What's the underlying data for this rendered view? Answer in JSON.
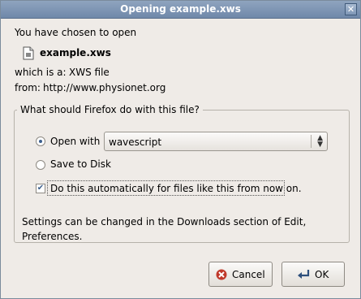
{
  "window": {
    "title": "Opening example.xws"
  },
  "intro": {
    "chosen_text": "You have chosen to open",
    "filename": "example.xws",
    "which_is_label": "which is a:",
    "which_is_value": "XWS file",
    "from_label": "from:",
    "from_value": "http://www.physionet.org"
  },
  "action_group": {
    "legend": "What should Firefox do with this file?",
    "open_with_label": "Open with",
    "open_with_selected": true,
    "app_select_value": "wavescript",
    "save_to_disk_label": "Save to Disk",
    "save_to_disk_selected": false,
    "auto_label": "Do this automatically for files like this from now on.",
    "auto_checked": true,
    "note_line1": "Settings can be changed in the Downloads section of Edit,",
    "note_line2": "Preferences."
  },
  "buttons": {
    "cancel_label": "Cancel",
    "ok_label": "OK"
  },
  "icons": {
    "file": "document-icon",
    "cancel": "cancel-x-icon",
    "ok": "ok-arrow-icon"
  },
  "colors": {
    "titlebar": "#7890ae",
    "window_bg": "#efebe7",
    "cancel_icon": "#c0392b"
  }
}
